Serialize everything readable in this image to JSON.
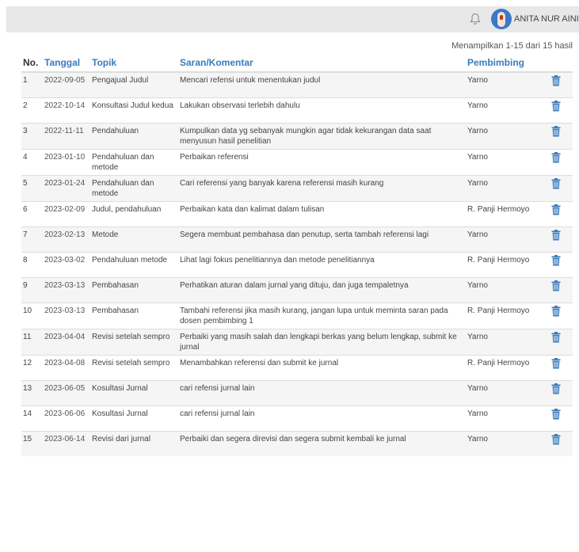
{
  "header": {
    "user_name": "ANITA NUR AINI",
    "icons": [
      "bell-icon",
      "avatar",
      "chevron-down-icon"
    ]
  },
  "summary": "Menampilkan 1-15 dari 15 hasil",
  "table": {
    "columns": [
      "No.",
      "Tanggal",
      "Topik",
      "Saran/Komentar",
      "Pembimbing"
    ],
    "rows": [
      {
        "no": "1",
        "tanggal": "2022-09-05",
        "topik": "Pengajual Judul",
        "saran": "Mencari refensi untuk menentukan judul",
        "pembimbing": "Yarno"
      },
      {
        "no": "2",
        "tanggal": "2022-10-14",
        "topik": "Konsultasi Judul kedua",
        "saran": "Lakukan observasi terlebih dahulu",
        "pembimbing": "Yarno"
      },
      {
        "no": "3",
        "tanggal": "2022-11-11",
        "topik": "Pendahuluan",
        "saran": "Kumpulkan data yg sebanyak mungkin agar tidak kekurangan data saat menyusun hasil penelitian",
        "pembimbing": "Yarno"
      },
      {
        "no": "4",
        "tanggal": "2023-01-10",
        "topik": "Pendahuluan dan metode",
        "saran": "Perbaikan referensi",
        "pembimbing": "Yarno"
      },
      {
        "no": "5",
        "tanggal": "2023-01-24",
        "topik": "Pendahuluan dan metode",
        "saran": "Cari referensi yang banyak karena referensi masih kurang",
        "pembimbing": "Yarno"
      },
      {
        "no": "6",
        "tanggal": "2023-02-09",
        "topik": "Judul, pendahuluan",
        "saran": "Perbaikan kata dan kalimat dalam tulisan",
        "pembimbing": "R. Panji Hermoyo"
      },
      {
        "no": "7",
        "tanggal": "2023-02-13",
        "topik": "Metode",
        "saran": "Segera membuat pembahasa dan penutup, serta tambah referensi lagi",
        "pembimbing": "Yarno"
      },
      {
        "no": "8",
        "tanggal": "2023-03-02",
        "topik": "Pendahuluan metode",
        "saran": "Lihat lagi fokus penelitiannya dan metode penelitiannya",
        "pembimbing": "R. Panji Hermoyo"
      },
      {
        "no": "9",
        "tanggal": "2023-03-13",
        "topik": "Pembahasan",
        "saran": "Perhatikan aturan dalam jurnal yang dituju, dan juga tempaletnya",
        "pembimbing": "Yarno"
      },
      {
        "no": "10",
        "tanggal": "2023-03-13",
        "topik": "Pembahasan",
        "saran": "Tambahi referensi jika masih kurang, jangan lupa untuk meminta saran pada dosen pembimbing 1",
        "pembimbing": "R. Panji Hermoyo"
      },
      {
        "no": "11",
        "tanggal": "2023-04-04",
        "topik": "Revisi setelah sempro",
        "saran": "Perbaiki yang masih salah dan lengkapi berkas yang belum lengkap, submit ke jurnal",
        "pembimbing": "Yarno"
      },
      {
        "no": "12",
        "tanggal": "2023-04-08",
        "topik": "Revisi setelah sempro",
        "saran": "Menambahkan referensi dan submit ke jurnal",
        "pembimbing": "R. Panji Hermoyo"
      },
      {
        "no": "13",
        "tanggal": "2023-06-05",
        "topik": "Kosultasi Jurnal",
        "saran": "cari refensi jurnal lain",
        "pembimbing": "Yarno"
      },
      {
        "no": "14",
        "tanggal": "2023-06-06",
        "topik": "Kosultasi Jurnal",
        "saran": "cari refensi jurnal lain",
        "pembimbing": "Yarno"
      },
      {
        "no": "15",
        "tanggal": "2023-06-14",
        "topik": "Revisi dari jurnal",
        "saran": "Perbaiki dan segera direvisi dan segera submit kembali ke jurnal",
        "pembimbing": "Yarno"
      }
    ],
    "row_action_icon": "trash-icon"
  },
  "colors": {
    "link": "#3a7bbd",
    "icon": "#3a7bbd",
    "topbar": "#e8e8e8",
    "alt_row": "#f5f5f5"
  }
}
